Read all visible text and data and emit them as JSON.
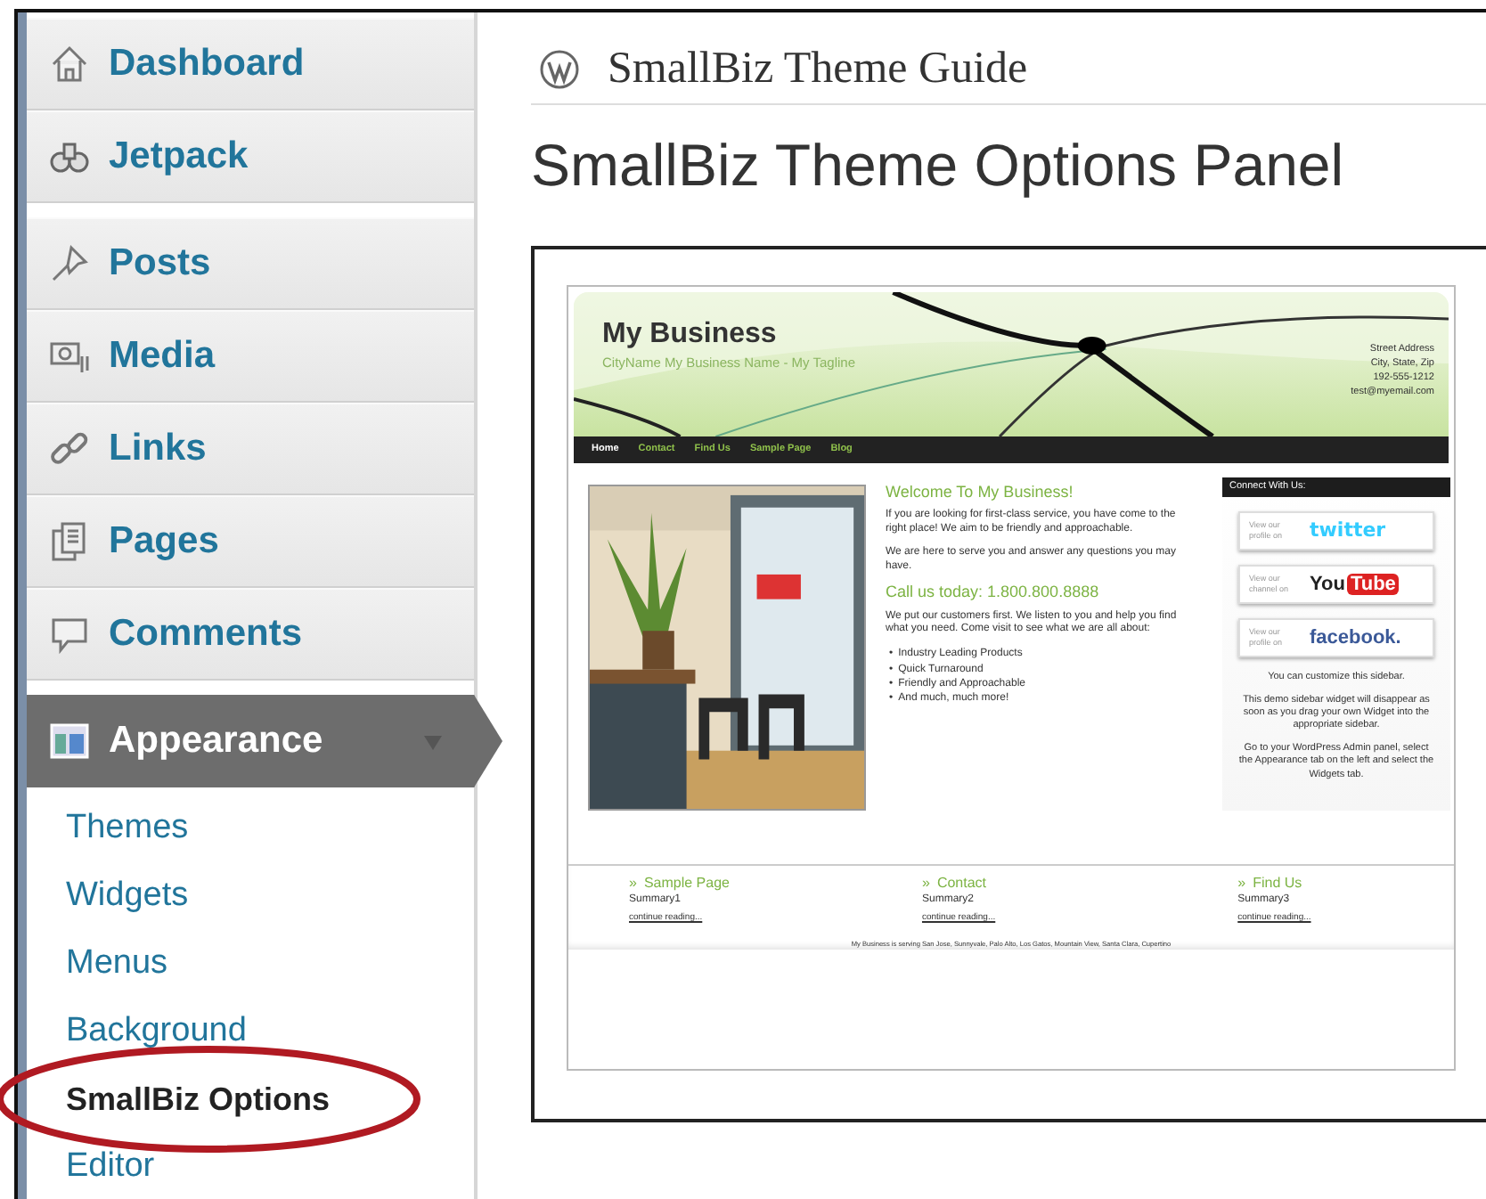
{
  "sidebar": {
    "items": [
      {
        "label": "Dashboard",
        "selected": false
      },
      {
        "label": "Jetpack",
        "selected": false
      },
      {
        "label": "Posts",
        "selected": false
      },
      {
        "label": "Media",
        "selected": false
      },
      {
        "label": "Links",
        "selected": false
      },
      {
        "label": "Pages",
        "selected": false
      },
      {
        "label": "Comments",
        "selected": false
      },
      {
        "label": "Appearance",
        "selected": true,
        "expanded": true,
        "children": [
          {
            "label": "Themes",
            "selected": false,
            "circled": false
          },
          {
            "label": "Widgets",
            "selected": false,
            "circled": false
          },
          {
            "label": "Menus",
            "selected": false,
            "circled": false
          },
          {
            "label": "Background",
            "selected": false,
            "circled": false
          },
          {
            "label": "SmallBiz Options",
            "selected": true,
            "circled": true
          },
          {
            "label": "Editor",
            "selected": false,
            "circled": false
          }
        ]
      }
    ]
  },
  "page": {
    "breadcrumb": "SmallBiz Theme Guide",
    "heading": "SmallBiz Theme Options Panel"
  },
  "preview": {
    "header": {
      "title": "My Business",
      "tagline": "CityName My Business Name - My Tagline",
      "address": [
        "Street Address",
        "City, State, Zip",
        "192-555-1212",
        "test@myemail.com"
      ]
    },
    "nav": [
      {
        "label": "Home",
        "selected": true
      },
      {
        "label": "Contact",
        "selected": false
      },
      {
        "label": "Find Us",
        "selected": false
      },
      {
        "label": "Sample Page",
        "selected": false
      },
      {
        "label": "Blog",
        "selected": false
      }
    ],
    "main": {
      "heading": "Welcome To My Business!",
      "intro": [
        "If you are looking for first-class service, you have come to the right place! We aim to be friendly and approachable.",
        "We are here to serve you and answer any questions you may have."
      ],
      "call": "Call us today: 1.800.800.8888",
      "text": "We put our customers first. We listen to you and help you find what you need. Come visit to see what we are all about:",
      "marker": "•",
      "bullets": [
        "Industry Leading Products",
        "Quick Turnaround",
        "Friendly and Approachable",
        "And much, much more!"
      ]
    },
    "widget": {
      "title": "Connect With Us:",
      "profiles": [
        {
          "kind": "twitter",
          "caption": "View our profile on",
          "brand": "twitter"
        },
        {
          "kind": "youtube",
          "caption": "View our channel on",
          "brand": "You",
          "brand_box": "Tube"
        },
        {
          "kind": "facebook",
          "caption": "View our profile on",
          "brand": "facebook."
        }
      ],
      "notes": [
        "You can customize this sidebar.",
        "This demo sidebar widget will disappear as soon as you drag your own Widget into the appropriate sidebar.",
        "Go to your WordPress Admin panel, select the Appearance tab on the left and select the Widgets tab."
      ]
    },
    "footer": {
      "marker": "»",
      "columns": [
        {
          "title": "Sample Page",
          "summary": "Summary1",
          "link": "continue reading..."
        },
        {
          "title": "Contact",
          "summary": "Summary2",
          "link": "continue reading..."
        },
        {
          "title": "Find Us",
          "summary": "Summary3",
          "link": "continue reading..."
        }
      ],
      "note": "My Business is serving San Jose, Sunnyvale, Palo Alto, Los Gatos, Mountain View, Santa Clara, Cupertino"
    }
  }
}
